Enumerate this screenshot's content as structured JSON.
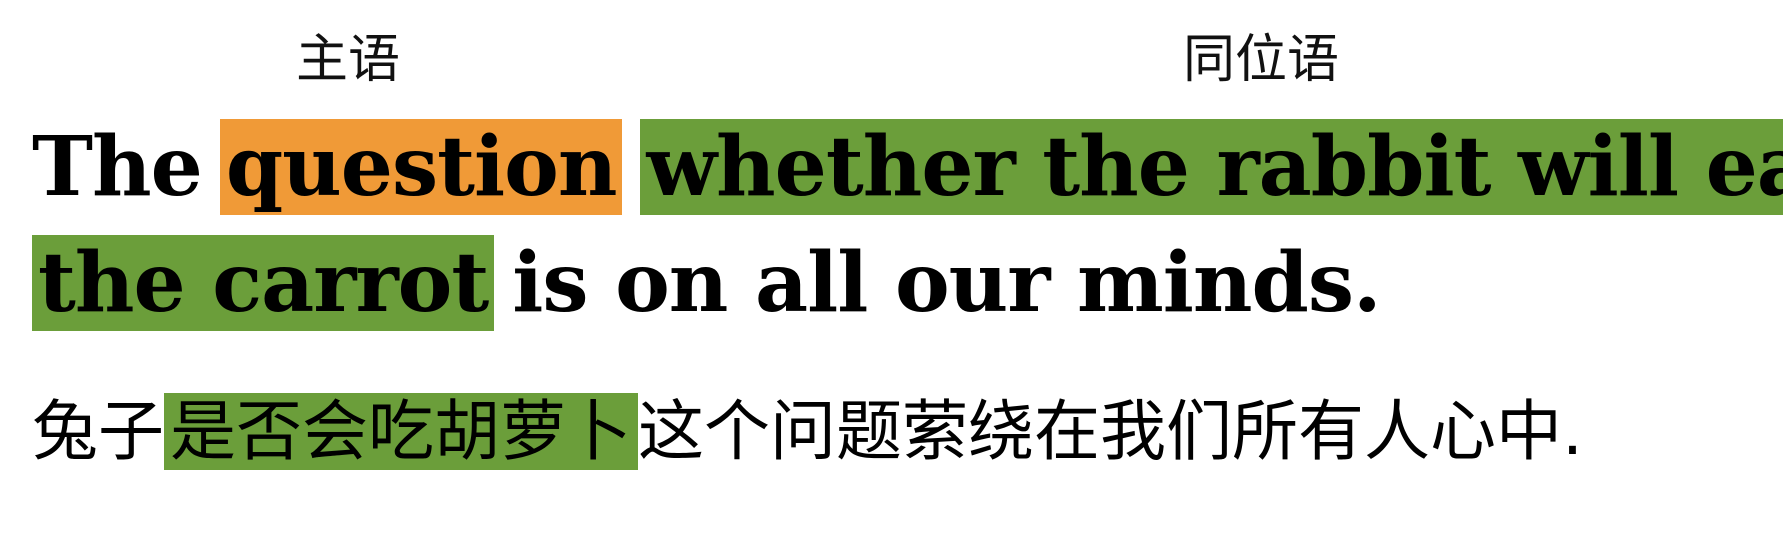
{
  "labels": {
    "subject": "主语",
    "appositive": "同位语"
  },
  "english": {
    "line1": {
      "prefix": "The",
      "subject": "question",
      "appositive_part1": "whether the rabbit will eat"
    },
    "line2": {
      "appositive_part2": "the carrot",
      "rest": "is on all our minds."
    }
  },
  "chinese": {
    "prefix": "兔子",
    "appositive": "是否会吃胡萝卜",
    "rest": "这个问题萦绕在我们所有人心中."
  },
  "colors": {
    "subject_highlight": "#F09A37",
    "appositive_highlight": "#6B9E3A"
  }
}
